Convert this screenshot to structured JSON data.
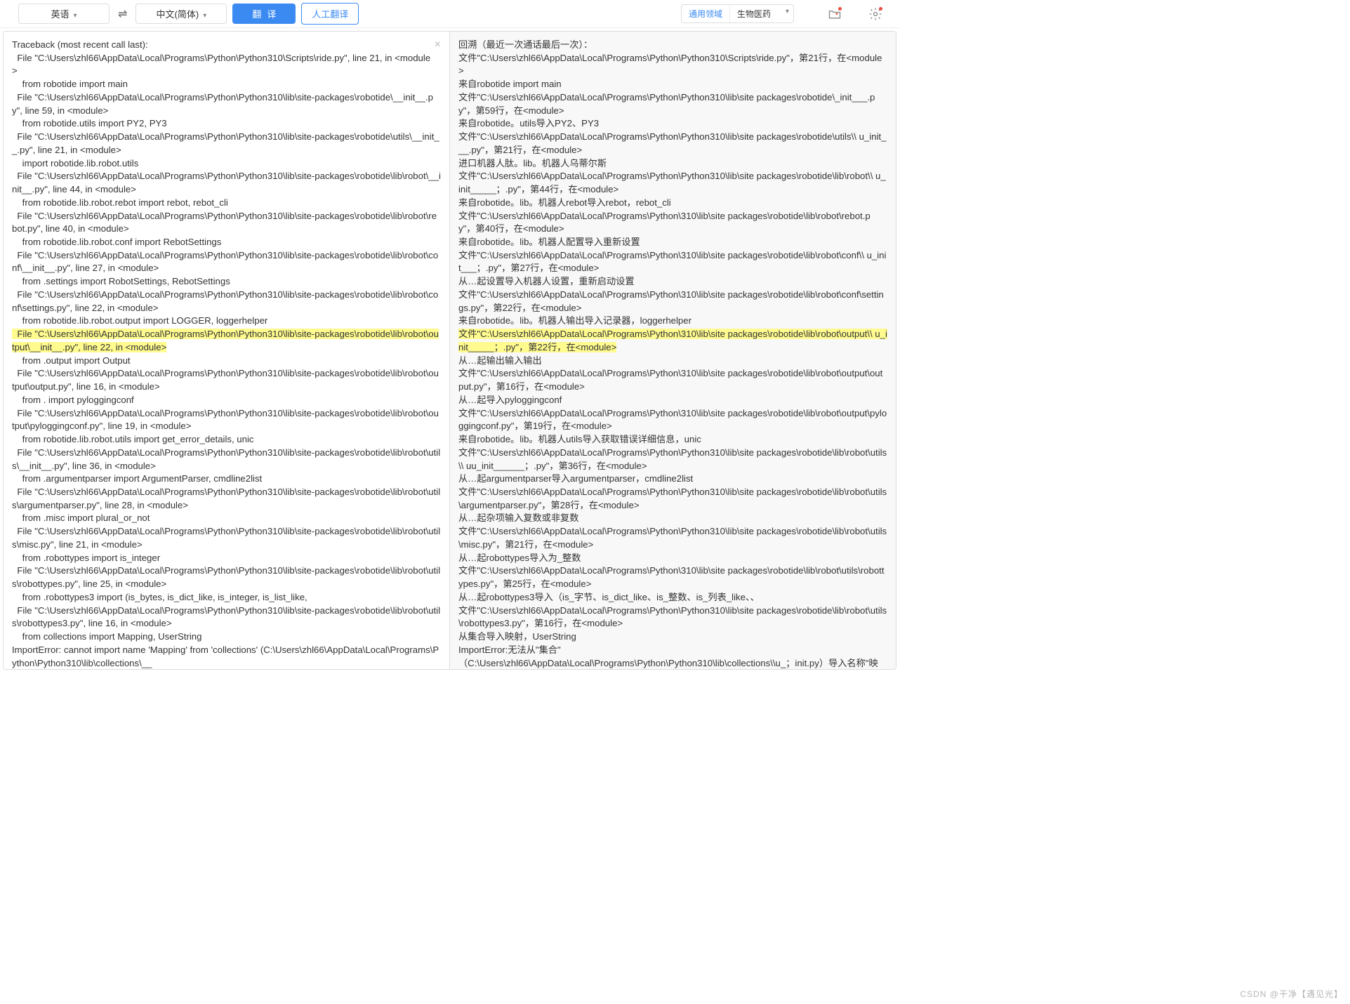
{
  "toolbar": {
    "source_lang": "英语",
    "target_lang": "中文(简体)",
    "translate_label": "翻译",
    "human_trans_label": "人工翻译",
    "domain_general": "通用领域",
    "domain_specific": "生物医药"
  },
  "source_lines": [
    {
      "t": "Traceback (most recent call last):"
    },
    {
      "t": "  File \"C:\\Users\\zhl66\\AppData\\Local\\Programs\\Python\\Python310\\Scripts\\ride.py\", line 21, in <module>"
    },
    {
      "t": "    from robotide import main"
    },
    {
      "t": "  File \"C:\\Users\\zhl66\\AppData\\Local\\Programs\\Python\\Python310\\lib\\site-packages\\robotide\\__init__.py\", line 59, in <module>"
    },
    {
      "t": "    from robotide.utils import PY2, PY3"
    },
    {
      "t": "  File \"C:\\Users\\zhl66\\AppData\\Local\\Programs\\Python\\Python310\\lib\\site-packages\\robotide\\utils\\__init__.py\", line 21, in <module>"
    },
    {
      "t": "    import robotide.lib.robot.utils"
    },
    {
      "t": "  File \"C:\\Users\\zhl66\\AppData\\Local\\Programs\\Python\\Python310\\lib\\site-packages\\robotide\\lib\\robot\\__init__.py\", line 44, in <module>"
    },
    {
      "t": "    from robotide.lib.robot.rebot import rebot, rebot_cli"
    },
    {
      "t": "  File \"C:\\Users\\zhl66\\AppData\\Local\\Programs\\Python\\Python310\\lib\\site-packages\\robotide\\lib\\robot\\rebot.py\", line 40, in <module>"
    },
    {
      "t": "    from robotide.lib.robot.conf import RebotSettings"
    },
    {
      "t": "  File \"C:\\Users\\zhl66\\AppData\\Local\\Programs\\Python\\Python310\\lib\\site-packages\\robotide\\lib\\robot\\conf\\__init__.py\", line 27, in <module>"
    },
    {
      "t": "    from .settings import RobotSettings, RebotSettings"
    },
    {
      "t": "  File \"C:\\Users\\zhl66\\AppData\\Local\\Programs\\Python\\Python310\\lib\\site-packages\\robotide\\lib\\robot\\conf\\settings.py\", line 22, in <module>"
    },
    {
      "t": "    from robotide.lib.robot.output import LOGGER, loggerhelper"
    },
    {
      "t": "  File \"C:\\Users\\zhl66\\AppData\\Local\\Programs\\Python\\Python310\\lib\\site-packages\\robotide\\lib\\robot\\output\\__init__.py\", line 22, in <module>",
      "hl": true
    },
    {
      "t": "    from .output import Output"
    },
    {
      "t": "  File \"C:\\Users\\zhl66\\AppData\\Local\\Programs\\Python\\Python310\\lib\\site-packages\\robotide\\lib\\robot\\output\\output.py\", line 16, in <module>"
    },
    {
      "t": "    from . import pyloggingconf"
    },
    {
      "t": "  File \"C:\\Users\\zhl66\\AppData\\Local\\Programs\\Python\\Python310\\lib\\site-packages\\robotide\\lib\\robot\\output\\pyloggingconf.py\", line 19, in <module>"
    },
    {
      "t": "    from robotide.lib.robot.utils import get_error_details, unic"
    },
    {
      "t": "  File \"C:\\Users\\zhl66\\AppData\\Local\\Programs\\Python\\Python310\\lib\\site-packages\\robotide\\lib\\robot\\utils\\__init__.py\", line 36, in <module>"
    },
    {
      "t": "    from .argumentparser import ArgumentParser, cmdline2list"
    },
    {
      "t": "  File \"C:\\Users\\zhl66\\AppData\\Local\\Programs\\Python\\Python310\\lib\\site-packages\\robotide\\lib\\robot\\utils\\argumentparser.py\", line 28, in <module>"
    },
    {
      "t": "    from .misc import plural_or_not"
    },
    {
      "t": "  File \"C:\\Users\\zhl66\\AppData\\Local\\Programs\\Python\\Python310\\lib\\site-packages\\robotide\\lib\\robot\\utils\\misc.py\", line 21, in <module>"
    },
    {
      "t": "    from .robottypes import is_integer"
    },
    {
      "t": "  File \"C:\\Users\\zhl66\\AppData\\Local\\Programs\\Python\\Python310\\lib\\site-packages\\robotide\\lib\\robot\\utils\\robottypes.py\", line 25, in <module>"
    },
    {
      "t": "    from .robottypes3 import (is_bytes, is_dict_like, is_integer, is_list_like,"
    },
    {
      "t": "  File \"C:\\Users\\zhl66\\AppData\\Local\\Programs\\Python\\Python310\\lib\\site-packages\\robotide\\lib\\robot\\utils\\robottypes3.py\", line 16, in <module>"
    },
    {
      "t": "    from collections import Mapping, UserString"
    },
    {
      "t": "ImportError: cannot import name 'Mapping' from 'collections' (C:\\Users\\zhl66\\AppData\\Local\\Programs\\Python\\Python310\\lib\\collections\\__"
    }
  ],
  "target_lines": [
    {
      "t": "回溯（最近一次通话最后一次）："
    },
    {
      "t": "文件\"C:\\Users\\zhl66\\AppData\\Local\\Programs\\Python\\Python310\\Scripts\\ride.py\"，第21行，在<module>"
    },
    {
      "t": "来自robotide import main"
    },
    {
      "t": "文件\"C:\\Users\\zhl66\\AppData\\Local\\Programs\\Python\\Python310\\lib\\site packages\\robotide\\_init___.py\"，第59行，在<module>"
    },
    {
      "t": "来自robotide。utils导入PY2、PY3"
    },
    {
      "t": "文件\"C:\\Users\\zhl66\\AppData\\Local\\Programs\\Python\\Python310\\lib\\site packages\\robotide\\utils\\\\ u_init___.py\"，第21行，在<module>"
    },
    {
      "t": "进口机器人肽。lib。机器人乌蒂尔斯"
    },
    {
      "t": "文件\"C:\\Users\\zhl66\\AppData\\Local\\Programs\\Python\\Python310\\lib\\site packages\\robotide\\lib\\robot\\\\ u_init_____；.py\"，第44行，在<module>"
    },
    {
      "t": "来自robotide。lib。机器人rebot导入rebot，rebot_cli"
    },
    {
      "t": "文件\"C:\\Users\\zhl66\\AppData\\Local\\Programs\\Python\\310\\lib\\site packages\\robotide\\lib\\robot\\rebot.py\"，第40行，在<module>"
    },
    {
      "t": "来自robotide。lib。机器人配置导入重新设置"
    },
    {
      "t": "文件\"C:\\Users\\zhl66\\AppData\\Local\\Programs\\Python\\310\\lib\\site packages\\robotide\\lib\\robot\\conf\\\\ u_init___；.py\"，第27行，在<module>"
    },
    {
      "t": "从…起设置导入机器人设置，重新启动设置"
    },
    {
      "t": "文件\"C:\\Users\\zhl66\\AppData\\Local\\Programs\\Python\\310\\lib\\site packages\\robotide\\lib\\robot\\conf\\settings.py\"，第22行，在<module>"
    },
    {
      "t": "来自robotide。lib。机器人输出导入记录器，loggerhelper"
    },
    {
      "t": "文件\"C:\\Users\\zhl66\\AppData\\Local\\Programs\\Python\\310\\lib\\site packages\\robotide\\lib\\robot\\output\\\\ u_init_____；.py\"，第22行，在<module>",
      "hl": true
    },
    {
      "t": "从…起输出输入输出"
    },
    {
      "t": "文件\"C:\\Users\\zhl66\\AppData\\Local\\Programs\\Python\\310\\lib\\site packages\\robotide\\lib\\robot\\output\\output.py\"，第16行，在<module>"
    },
    {
      "t": "从…起导入pyloggingconf"
    },
    {
      "t": "文件\"C:\\Users\\zhl66\\AppData\\Local\\Programs\\Python\\310\\lib\\site packages\\robotide\\lib\\robot\\output\\pyloggingconf.py\"，第19行，在<module>"
    },
    {
      "t": "来自robotide。lib。机器人utils导入获取错误详细信息，unic"
    },
    {
      "t": "文件\"C:\\Users\\zhl66\\AppData\\Local\\Programs\\Python\\Python310\\lib\\site packages\\robotide\\lib\\robot\\utils\\\\ uu_init______；.py\"，第36行，在<module>"
    },
    {
      "t": "从…起argumentparser导入argumentparser，cmdline2list"
    },
    {
      "t": "文件\"C:\\Users\\zhl66\\AppData\\Local\\Programs\\Python\\Python310\\lib\\site packages\\robotide\\lib\\robot\\utils\\argumentparser.py\"，第28行，在<module>"
    },
    {
      "t": "从…起杂项输入复数或非复数"
    },
    {
      "t": "文件\"C:\\Users\\zhl66\\AppData\\Local\\Programs\\Python\\Python310\\lib\\site packages\\robotide\\lib\\robot\\utils\\misc.py\"，第21行，在<module>"
    },
    {
      "t": "从…起robottypes导入为_整数"
    },
    {
      "t": "文件\"C:\\Users\\zhl66\\AppData\\Local\\Programs\\Python\\310\\lib\\site packages\\robotide\\lib\\robot\\utils\\robottypes.py\"，第25行，在<module>"
    },
    {
      "t": "从…起robottypes3导入（is_字节、is_dict_like、is_整数、is_列表_like、、"
    },
    {
      "t": "文件\"C:\\Users\\zhl66\\AppData\\Local\\Programs\\Python\\Python310\\lib\\site packages\\robotide\\lib\\robot\\utils\\robottypes3.py\"，第16行，在<module>"
    },
    {
      "t": "从集合导入映射，UserString"
    },
    {
      "t": "ImportError:无法从\"集合\""
    },
    {
      "t": "（C:\\Users\\zhl66\\AppData\\Local\\Programs\\Python\\Python310\\lib\\collections\\\\u_；init.py）导入名称\"映射\""
    }
  ],
  "watermark": "CSDN @干净【遇见光】"
}
